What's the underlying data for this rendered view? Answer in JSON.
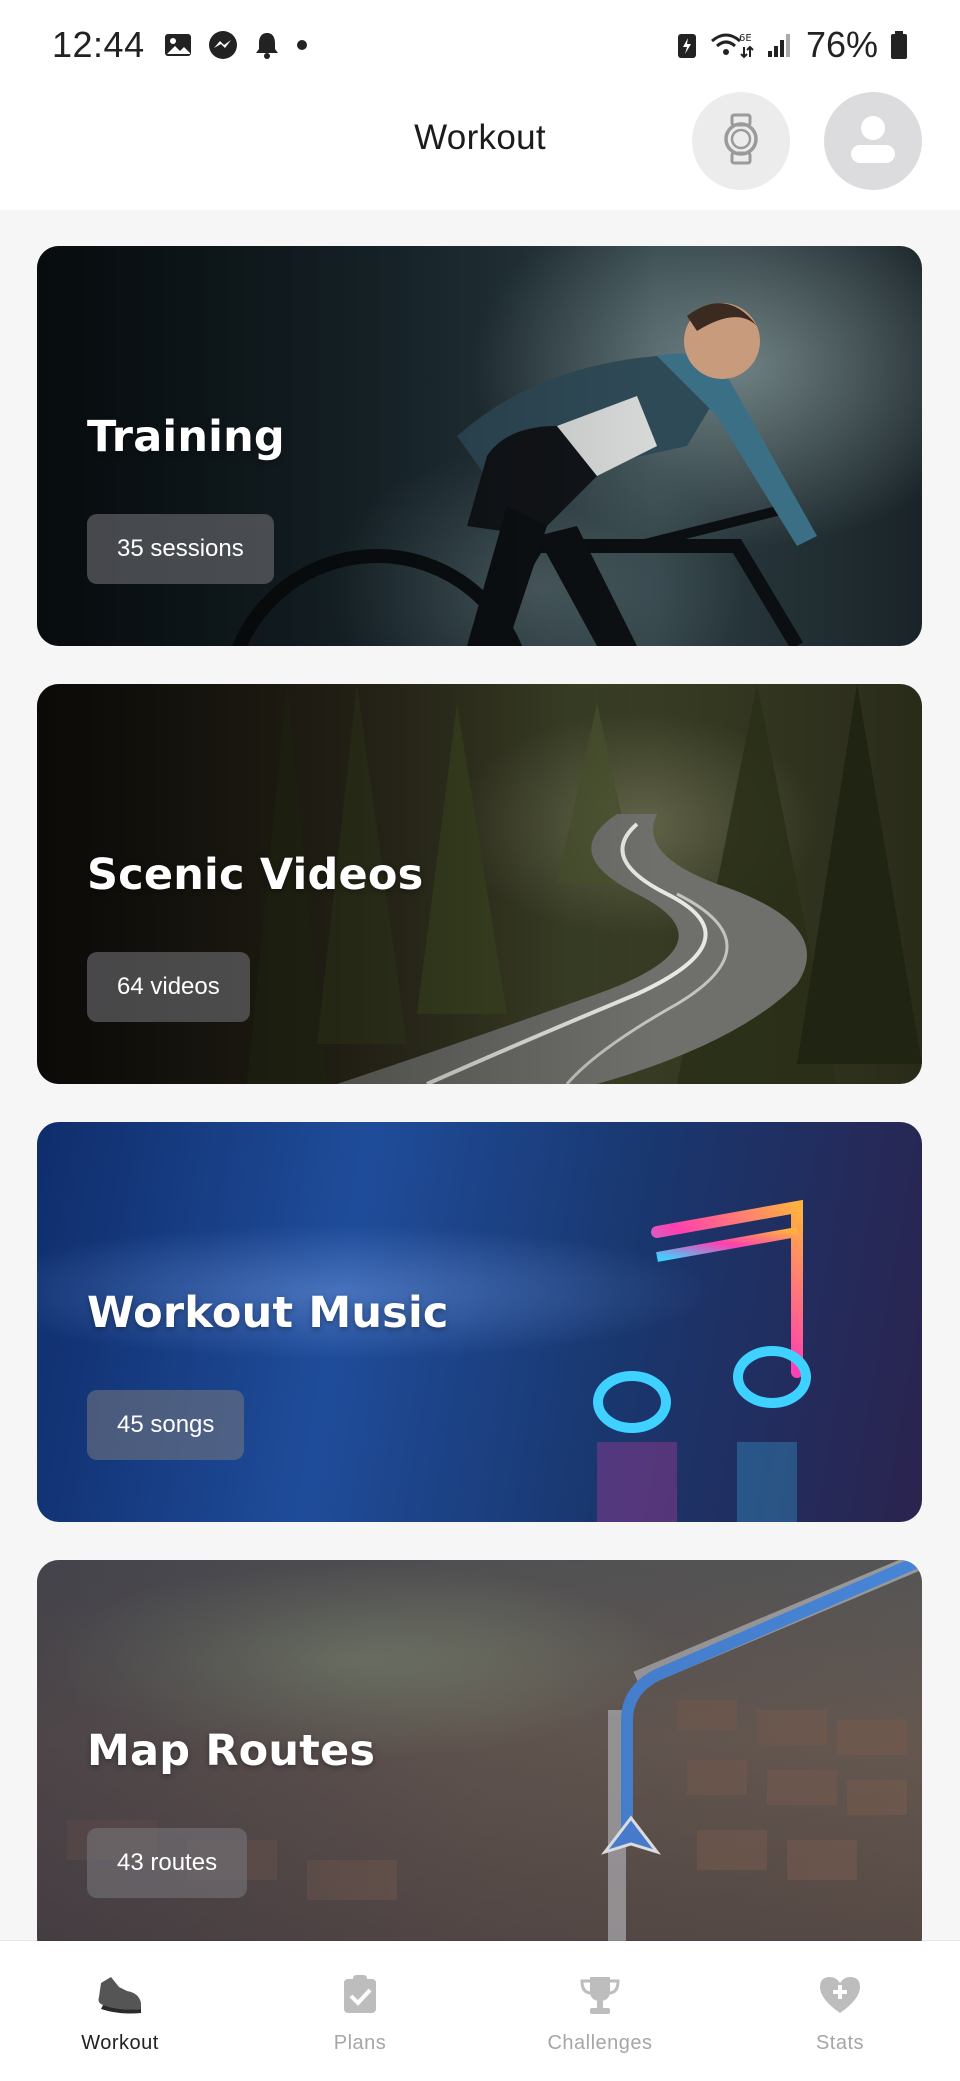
{
  "status_bar": {
    "time": "12:44",
    "battery": "76%"
  },
  "header": {
    "title": "Workout"
  },
  "cards": [
    {
      "title": "Training",
      "badge": "35 sessions"
    },
    {
      "title": "Scenic Videos",
      "badge": "64 videos"
    },
    {
      "title": "Workout Music",
      "badge": "45 songs"
    },
    {
      "title": "Map Routes",
      "badge": "43 routes"
    }
  ],
  "bottom_nav": {
    "items": [
      {
        "label": "Workout",
        "icon": "sneaker-icon"
      },
      {
        "label": "Plans",
        "icon": "clipboard-check-icon"
      },
      {
        "label": "Challenges",
        "icon": "trophy-icon"
      },
      {
        "label": "Stats",
        "icon": "heart-plus-icon"
      }
    ],
    "active": "Workout"
  },
  "colors": {
    "nav_active": "#222222",
    "nav_inactive": "#a6a6a6",
    "header_bg": "#ffffff",
    "page_bg": "#f6f6f7"
  }
}
